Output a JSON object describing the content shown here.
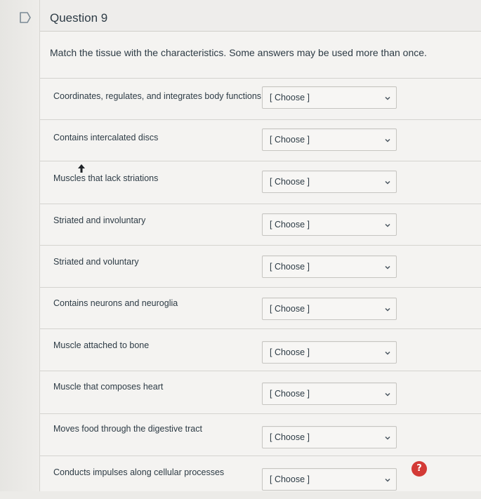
{
  "question": {
    "title": "Question 9",
    "instructions": "Match the tissue with the characteristics. Some answers may be used more than once."
  },
  "items": [
    {
      "label": "Coordinates, regulates, and integrates body functions",
      "value": "[ Choose ]"
    },
    {
      "label": "Contains intercalated discs",
      "value": "[ Choose ]"
    },
    {
      "label": "Muscles that lack striations",
      "value": "[ Choose ]"
    },
    {
      "label": "Striated and involuntary",
      "value": "[ Choose ]"
    },
    {
      "label": "Striated and voluntary",
      "value": "[ Choose ]"
    },
    {
      "label": "Contains neurons and neuroglia",
      "value": "[ Choose ]"
    },
    {
      "label": "Muscle attached to bone",
      "value": "[ Choose ]"
    },
    {
      "label": "Muscle that composes heart",
      "value": "[ Choose ]"
    },
    {
      "label": "Moves food through the digestive tract",
      "value": "[ Choose ]"
    },
    {
      "label": "Conducts impulses along cellular processes",
      "value": "[ Choose ]"
    }
  ],
  "help_badge": {
    "glyph": "?",
    "color": "#d33a36"
  },
  "icons": {
    "flag": "flag-icon",
    "chevron": "chevron-down-icon",
    "cursor": "mouse-cursor-icon"
  }
}
